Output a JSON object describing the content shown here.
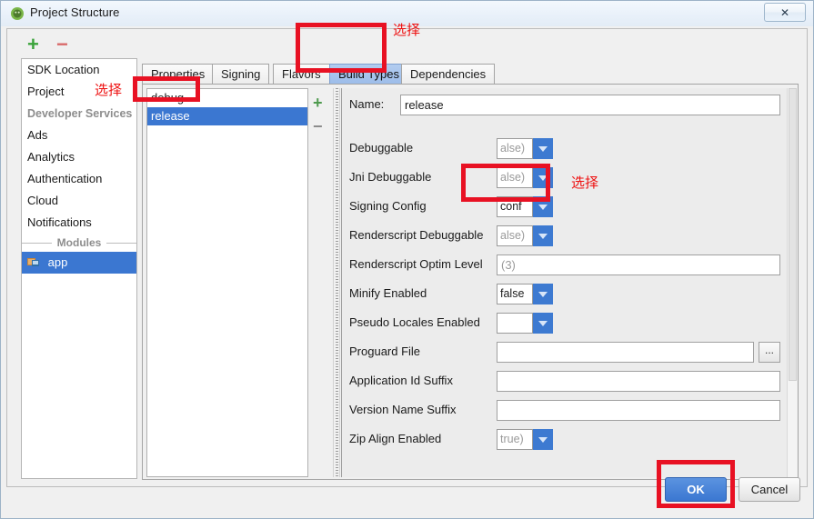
{
  "window": {
    "title": "Project Structure",
    "app_icon": "android-studio-icon",
    "close_label": "✕"
  },
  "sidebar": {
    "toolbar": {
      "add_label": "+",
      "remove_label": "−"
    },
    "items": [
      {
        "label": "SDK Location",
        "type": "item",
        "selected": false
      },
      {
        "label": "Project",
        "type": "item",
        "selected": false
      },
      {
        "label": "Developer Services",
        "type": "group",
        "selected": false
      },
      {
        "label": "Ads",
        "type": "item",
        "selected": false
      },
      {
        "label": "Analytics",
        "type": "item",
        "selected": false
      },
      {
        "label": "Authentication",
        "type": "item",
        "selected": false
      },
      {
        "label": "Cloud",
        "type": "item",
        "selected": false
      },
      {
        "label": "Notifications",
        "type": "item",
        "selected": false
      }
    ],
    "modules_separator": "Modules",
    "modules": [
      {
        "label": "app",
        "icon": "module-icon",
        "selected": true
      }
    ]
  },
  "tabs": [
    {
      "label": "Properties",
      "active": false
    },
    {
      "label": "Signing",
      "active": false
    },
    {
      "label": "Flavors",
      "active": false
    },
    {
      "label": "Build Types",
      "active": true
    },
    {
      "label": "Dependencies",
      "active": false
    }
  ],
  "build_types": {
    "items": [
      {
        "label": "debug",
        "selected": false
      },
      {
        "label": "release",
        "selected": true
      }
    ],
    "add_label": "+",
    "remove_label": "−"
  },
  "form": {
    "name_label": "Name:",
    "name_value": "release",
    "fields": [
      {
        "label": "Debuggable",
        "kind": "combo",
        "value": "alse)",
        "is_placeholder": true
      },
      {
        "label": "Jni Debuggable",
        "kind": "combo",
        "value": "alse)",
        "is_placeholder": true
      },
      {
        "label": "Signing Config",
        "kind": "combo",
        "value": "conf",
        "is_placeholder": false
      },
      {
        "label": "Renderscript Debuggable",
        "kind": "combo",
        "value": "alse)",
        "is_placeholder": true
      },
      {
        "label": "Renderscript Optim Level",
        "kind": "text",
        "value": "(3)",
        "is_placeholder": true
      },
      {
        "label": "Minify Enabled",
        "kind": "combo",
        "value": "false",
        "is_placeholder": false
      },
      {
        "label": "Pseudo Locales Enabled",
        "kind": "combo",
        "value": "",
        "is_placeholder": true
      },
      {
        "label": "Proguard File",
        "kind": "text-browse",
        "value": "",
        "is_placeholder": false,
        "browse_label": "..."
      },
      {
        "label": "Application Id Suffix",
        "kind": "text",
        "value": "",
        "is_placeholder": false
      },
      {
        "label": "Version Name Suffix",
        "kind": "text",
        "value": "",
        "is_placeholder": false
      },
      {
        "label": "Zip Align Enabled",
        "kind": "combo",
        "value": "true)",
        "is_placeholder": true
      }
    ]
  },
  "footer": {
    "ok_label": "OK",
    "cancel_label": "Cancel"
  },
  "annotations": {
    "accent_color": "#e81123",
    "text_color": "#ee1111",
    "notes": [
      {
        "text": "选择"
      },
      {
        "text": "选择"
      },
      {
        "text": "选择"
      }
    ]
  }
}
